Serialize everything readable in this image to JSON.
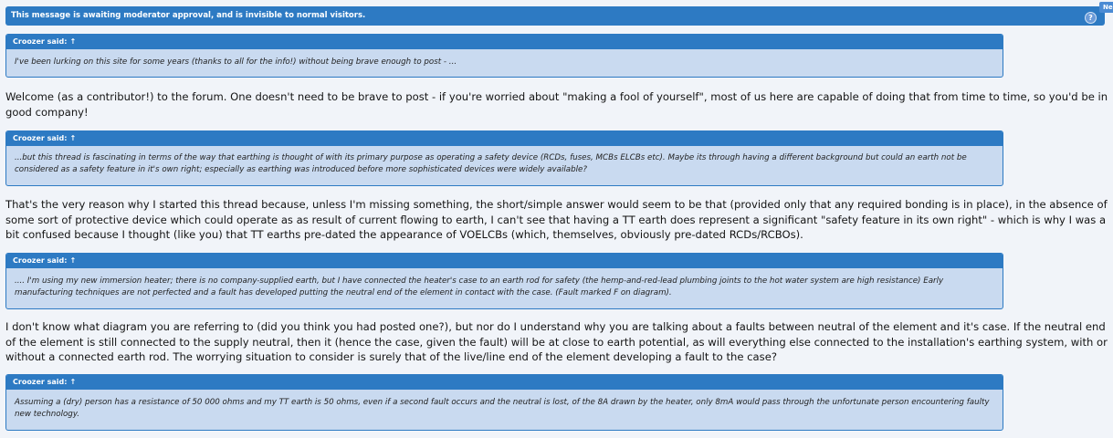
{
  "moderation": {
    "message": "This message is awaiting moderator approval, and is invisible to normal visitors.",
    "help_glyph": "?",
    "corner_badge": "Ne"
  },
  "posts": [
    {
      "quote_author": "Croozer said:",
      "quote_arrow": "↑",
      "quote_text": "I've been lurking on this site for some years (thanks to all for the info!) without being brave enough to post - ...",
      "reply": "Welcome (as a contributor!) to the forum. One doesn't need to be brave to post - if you're worried about \"making a fool of yourself\", most of us here are capable of doing that from time to time, so you'd be in good company!"
    },
    {
      "quote_author": "Croozer said:",
      "quote_arrow": "↑",
      "quote_text": "...but this thread is fascinating in terms of the way that earthing is thought of with its primary purpose as operating a safety device (RCDs, fuses, MCBs ELCBs etc). Maybe its through having a different background but could an earth not be considered as a safety feature in it's own right; especially as earthing was introduced before more sophisticated devices were widely available?",
      "reply": "That's the very reason why I started this thread because, unless I'm missing something, the short/simple answer would seem to be that (provided only that any required bonding is in place), in the absence of some sort of protective device which could operate as as result of current flowing to earth, I can't see that having a TT earth does represent a significant \"safety feature in its own right\" - which is why I was a bit confused because I thought (like you) that TT earths pre-dated the appearance of VOELCBs (which, themselves, obviously pre-dated RCDs/RCBOs)."
    },
    {
      "quote_author": "Croozer said:",
      "quote_arrow": "↑",
      "quote_text": ".... I'm using my new immersion heater; there is no company-supplied earth, but I have connected the heater's case to an earth rod for safety (the hemp-and-red-lead plumbing joints to the hot water system are high resistance) Early manufacturing techniques are not perfected and a fault has developed putting the neutral end of the element in contact with the case. (Fault marked F on diagram).",
      "reply": "I don't know what diagram you are referring to (did you think you had posted one?), but nor do I understand why you are talking about a faults between neutral of the element and it's case. If the neutral end of the element is still connected to the supply neutral, then it (hence the case, given the fault) will be at close to earth potential, as will everything else connected to the installation's earthing system, with or without a connected earth rod. The worrying situation to consider is surely that of the live/line end of the element developing a fault to the case?"
    },
    {
      "quote_author": "Croozer said:",
      "quote_arrow": "↑",
      "quote_text": "Assuming a (dry) person has a resistance of 50 000 ohms and my TT earth is 50 ohms, even if a second fault occurs and the neutral is lost, of the 8A drawn by the heater, only 8mA would pass through the unfortunate person encountering faulty new technology."
    }
  ]
}
